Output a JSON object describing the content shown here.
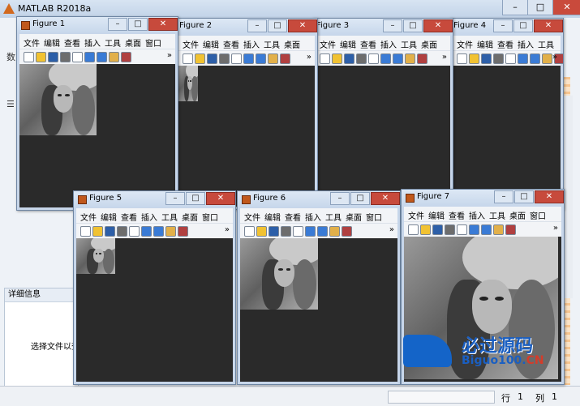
{
  "main_window": {
    "title": "MATLAB R2018a",
    "side_labels": [
      "数",
      "☰"
    ],
    "details_header": "详细信息",
    "details_body": "选择文件以查",
    "status": {
      "row_label": "行",
      "row_value": "1",
      "col_label": "列",
      "col_value": "1"
    }
  },
  "figure_menu": [
    "文件",
    "编辑",
    "查看",
    "插入",
    "工具",
    "桌面",
    "窗口",
    "帮助"
  ],
  "figures": [
    {
      "title": "Figure 1"
    },
    {
      "title": "Figure 2"
    },
    {
      "title": "Figure 3"
    },
    {
      "title": "Figure 4"
    },
    {
      "title": "Figure 5"
    },
    {
      "title": "Figure 6"
    },
    {
      "title": "Figure 7"
    }
  ],
  "watermark": {
    "top": "必过源码",
    "bottom_main": "Biguo100.",
    "bottom_suffix": "CN"
  },
  "colors": {
    "titlebar": "#c7d7eb",
    "canvas": "#2a2a2a",
    "close": "#c74a3c",
    "watermark_blue": "#1a5fc2"
  }
}
